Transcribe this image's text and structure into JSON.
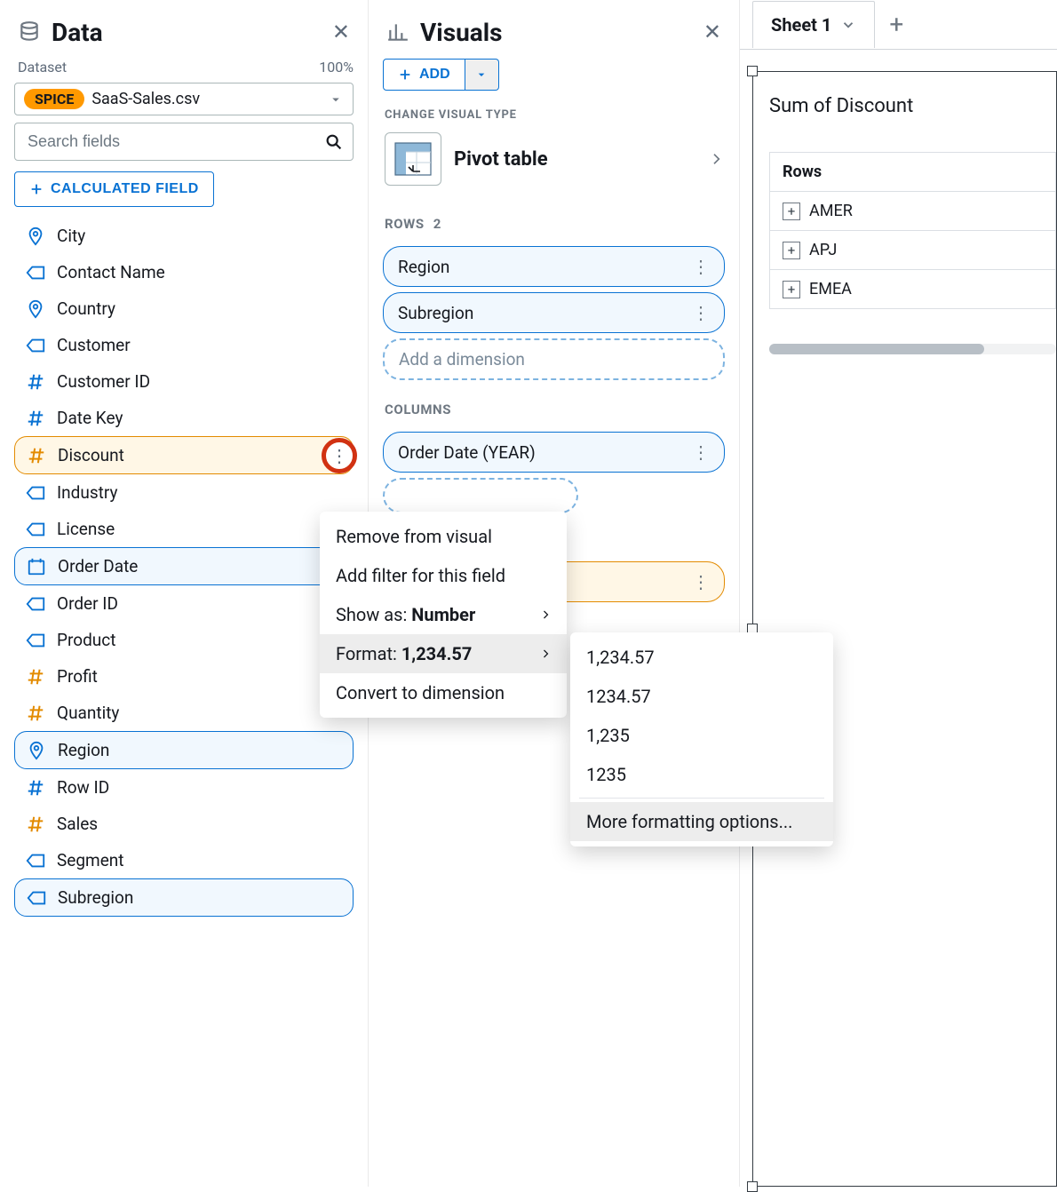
{
  "data_panel": {
    "title": "Data",
    "dataset_label": "Dataset",
    "zoom": "100%",
    "spice": "SPICE",
    "dataset_name": "SaaS-Sales.csv",
    "search_placeholder": "Search fields",
    "calc_button": "CALCULATED FIELD",
    "fields": [
      {
        "icon": "pin",
        "color": "#0972d3",
        "label": "City"
      },
      {
        "icon": "tag",
        "color": "#0972d3",
        "label": "Contact Name"
      },
      {
        "icon": "pin",
        "color": "#0972d3",
        "label": "Country"
      },
      {
        "icon": "tag",
        "color": "#0972d3",
        "label": "Customer"
      },
      {
        "icon": "hash",
        "color": "#0972d3",
        "label": "Customer ID"
      },
      {
        "icon": "hash",
        "color": "#0972d3",
        "label": "Date Key"
      },
      {
        "icon": "hash",
        "color": "#e38b00",
        "label": "Discount",
        "sel": "orange",
        "menu": true
      },
      {
        "icon": "tag",
        "color": "#0972d3",
        "label": "Industry"
      },
      {
        "icon": "tag",
        "color": "#0972d3",
        "label": "License"
      },
      {
        "icon": "date",
        "color": "#0972d3",
        "label": "Order Date",
        "sel": "blue"
      },
      {
        "icon": "tag",
        "color": "#0972d3",
        "label": "Order ID"
      },
      {
        "icon": "tag",
        "color": "#0972d3",
        "label": "Product"
      },
      {
        "icon": "hash",
        "color": "#e38b00",
        "label": "Profit"
      },
      {
        "icon": "hash",
        "color": "#e38b00",
        "label": "Quantity"
      },
      {
        "icon": "pin",
        "color": "#0972d3",
        "label": "Region",
        "sel": "blue"
      },
      {
        "icon": "hash",
        "color": "#0972d3",
        "label": "Row ID"
      },
      {
        "icon": "hash",
        "color": "#e38b00",
        "label": "Sales"
      },
      {
        "icon": "tag",
        "color": "#0972d3",
        "label": "Segment"
      },
      {
        "icon": "tag",
        "color": "#0972d3",
        "label": "Subregion",
        "sel": "blue"
      }
    ]
  },
  "visuals_panel": {
    "title": "Visuals",
    "add": "ADD",
    "change_type": "CHANGE VISUAL TYPE",
    "vtype": "Pivot table",
    "rows_label": "ROWS",
    "rows_count": "2",
    "rows": [
      "Region",
      "Subregion"
    ],
    "rows_placeholder": "Add a dimension",
    "columns_label": "COLUMNS",
    "columns": [
      "Order Date (YEAR)"
    ]
  },
  "sheet_panel": {
    "tab": "Sheet 1",
    "canvas_title": "Sum of Discount",
    "rows_header": "Rows",
    "rows": [
      "AMER",
      "APJ",
      "EMEA"
    ]
  },
  "context_menu": {
    "items": [
      {
        "label": "Remove from visual"
      },
      {
        "label": "Add filter for this field"
      },
      {
        "label_prefix": "Show as: ",
        "label_bold": "Number",
        "chevron": true
      },
      {
        "label_prefix": "Format: ",
        "label_bold": "1,234.57",
        "chevron": true,
        "highlight": true
      },
      {
        "label": "Convert to dimension"
      }
    ]
  },
  "format_submenu": {
    "options": [
      "1,234.57",
      "1234.57",
      "1,235",
      "1235"
    ],
    "more": "More formatting options..."
  }
}
